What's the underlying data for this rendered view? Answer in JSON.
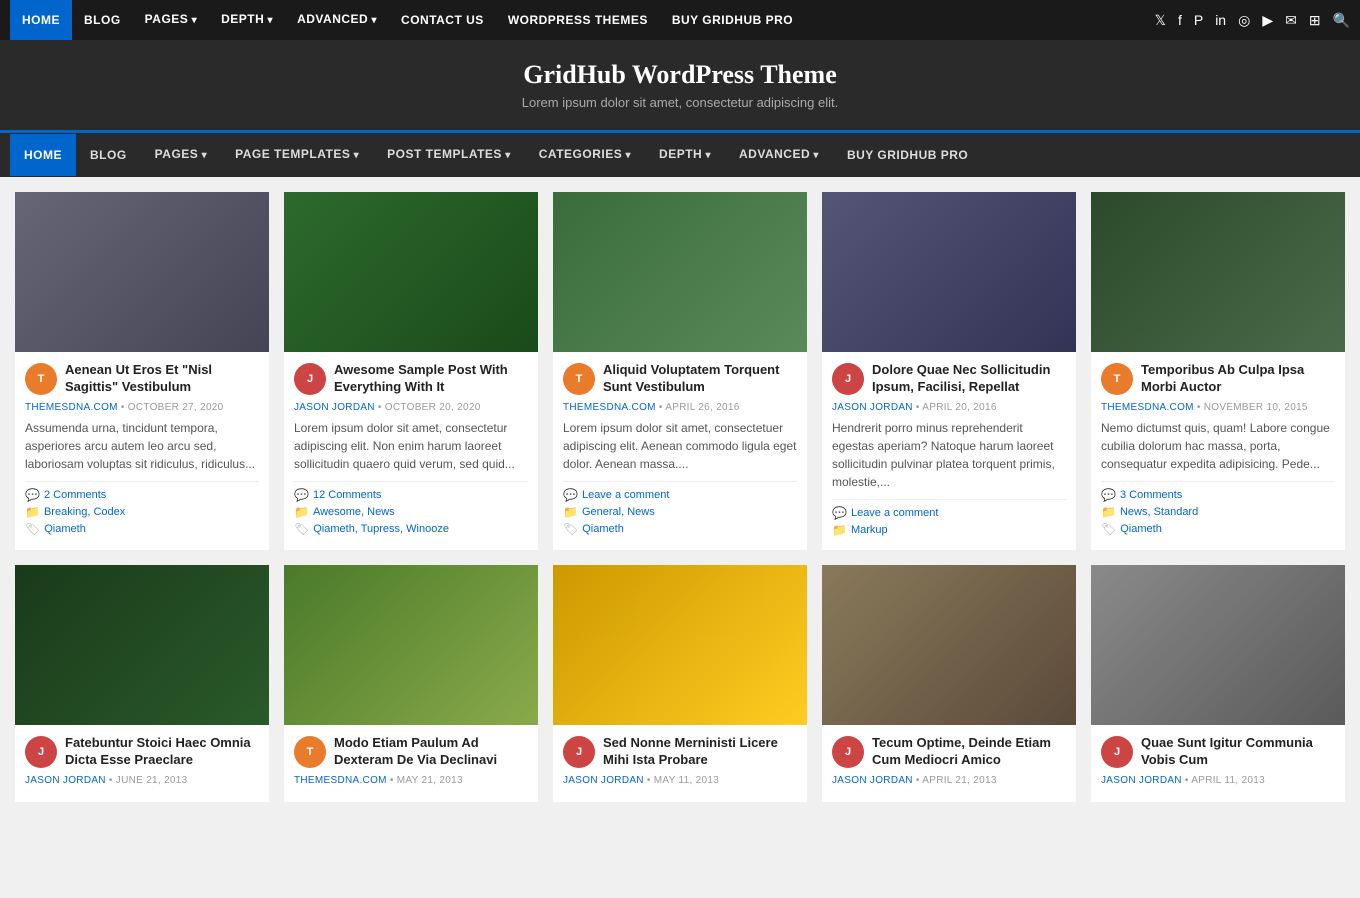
{
  "topNav": {
    "links": [
      {
        "label": "HOME",
        "active": true
      },
      {
        "label": "BLOG",
        "active": false
      },
      {
        "label": "PAGES",
        "active": false,
        "hasArrow": true
      },
      {
        "label": "DEPTH",
        "active": false,
        "hasArrow": true
      },
      {
        "label": "ADVANCED",
        "active": false,
        "hasArrow": true
      },
      {
        "label": "CONTACT US",
        "active": false
      },
      {
        "label": "WORDPRESS THEMES",
        "active": false
      },
      {
        "label": "BUY GRIDHUB PRO",
        "active": false
      }
    ],
    "icons": [
      "𝕏",
      "f",
      "𝓟",
      "in",
      "📷",
      "▶",
      "✉",
      "⊞",
      "🔍"
    ]
  },
  "header": {
    "title": "GridHub WordPress Theme",
    "tagline": "Lorem ipsum dolor sit amet, consectetur adipiscing elit."
  },
  "secNav": {
    "links": [
      {
        "label": "HOME",
        "active": true
      },
      {
        "label": "BLOG",
        "active": false
      },
      {
        "label": "PAGES",
        "active": false,
        "hasArrow": true
      },
      {
        "label": "PAGE TEMPLATES",
        "active": false,
        "hasArrow": true
      },
      {
        "label": "POST TEMPLATES",
        "active": false,
        "hasArrow": true
      },
      {
        "label": "CATEGORIES",
        "active": false,
        "hasArrow": true
      },
      {
        "label": "DEPTH",
        "active": false,
        "hasArrow": true
      },
      {
        "label": "ADVANCED",
        "active": false,
        "hasArrow": true
      },
      {
        "label": "BUY GRIDHUB PRO",
        "active": false
      }
    ]
  },
  "posts": [
    {
      "id": 1,
      "imgClass": "img-mask",
      "avatarClass": "avatar-orange",
      "avatarText": "T",
      "title": "Aenean Ut Eros Et \"Nisl Sagittis\" Vestibulum",
      "byline": "THEMESDNA.COM",
      "date": "OCTOBER 27, 2020",
      "excerpt": "Assumenda urna, tincidunt tempora, asperiores arcu autem leo arcu sed, laboriosam voluptas sit ridiculus, ridiculus...",
      "comments": "2 Comments",
      "categories": "Breaking, Codex",
      "tags": "Qiameth"
    },
    {
      "id": 2,
      "imgClass": "img-nature",
      "avatarClass": "avatar-red",
      "avatarText": "J",
      "title": "Awesome Sample Post With Everything With It",
      "byline": "JASON JORDAN",
      "date": "OCTOBER 20, 2020",
      "excerpt": "Lorem ipsum dolor sit amet, consectetur adipiscing elit. Non enim harum laoreet sollicitudin quaero quid verum, sed quid...",
      "comments": "12 Comments",
      "categories": "Awesome, News",
      "tags": "Qiameth, Tupress, Winooze"
    },
    {
      "id": 3,
      "imgClass": "img-eggs",
      "avatarClass": "avatar-orange",
      "avatarText": "T",
      "title": "Aliquid Voluptatem Torquent Sunt Vestibulum",
      "byline": "THEMESDNA.COM",
      "date": "APRIL 26, 2016",
      "excerpt": "Lorem ipsum dolor sit amet, consectetuer adipiscing elit. Aenean commodo ligula eget dolor. Aenean massa....",
      "comments": "Leave a comment",
      "categories": "General, News",
      "tags": "Qiameth"
    },
    {
      "id": 4,
      "imgClass": "img-city",
      "avatarClass": "avatar-red",
      "avatarText": "J",
      "title": "Dolore Quae Nec Sollicitudin Ipsum, Facilisi, Repellat",
      "byline": "JASON JORDAN",
      "date": "APRIL 20, 2016",
      "excerpt": "Hendrerit porro minus reprehenderit egestas aperiam? Natoque harum laoreet sollicitudin pulvinar platea torquent primis, molestie,...",
      "comments": "Leave a comment",
      "categories": "Markup",
      "tags": ""
    },
    {
      "id": 5,
      "imgClass": "img-photo",
      "avatarClass": "avatar-orange",
      "avatarText": "T",
      "title": "Temporibus Ab Culpa Ipsa Morbi Auctor",
      "byline": "THEMESDNA.COM",
      "date": "NOVEMBER 10, 2015",
      "excerpt": "Nemo dictumst quis, quam! Labore congue cubilia dolorum hac massa, porta, consequatur expedita adipisicing. Pede...",
      "comments": "3 Comments",
      "categories": "News, Standard",
      "tags": "Qiameth"
    },
    {
      "id": 6,
      "imgClass": "img-xmas",
      "avatarClass": "avatar-red",
      "avatarText": "J",
      "title": "Fatebuntur Stoici Haec Omnia Dicta Esse Praeclare",
      "byline": "JASON JORDAN",
      "date": "JUNE 21, 2013",
      "excerpt": "",
      "comments": "",
      "categories": "",
      "tags": ""
    },
    {
      "id": 7,
      "imgClass": "img-windmill",
      "avatarClass": "avatar-orange",
      "avatarText": "T",
      "title": "Modo Etiam Paulum Ad Dexteram De Via Declinavi",
      "byline": "THEMESDNA.COM",
      "date": "MAY 21, 2013",
      "excerpt": "",
      "comments": "",
      "categories": "",
      "tags": ""
    },
    {
      "id": 8,
      "imgClass": "img-girl",
      "avatarClass": "avatar-red",
      "avatarText": "J",
      "title": "Sed Nonne Merninisti Licere Mihi Ista Probare",
      "byline": "JASON JORDAN",
      "date": "MAY 11, 2013",
      "excerpt": "",
      "comments": "",
      "categories": "",
      "tags": ""
    },
    {
      "id": 9,
      "imgClass": "img-typewriter",
      "avatarClass": "avatar-red",
      "avatarText": "J",
      "title": "Tecum Optime, Deinde Etiam Cum Mediocri Amico",
      "byline": "JASON JORDAN",
      "date": "APRIL 21, 2013",
      "excerpt": "",
      "comments": "",
      "categories": "",
      "tags": ""
    },
    {
      "id": 10,
      "imgClass": "img-keyboard",
      "avatarClass": "avatar-red",
      "avatarText": "J",
      "title": "Quae Sunt Igitur Communia Vobis Cum",
      "byline": "JASON JORDAN",
      "date": "APRIL 11, 2013",
      "excerpt": "",
      "comments": "",
      "categories": "",
      "tags": ""
    }
  ]
}
